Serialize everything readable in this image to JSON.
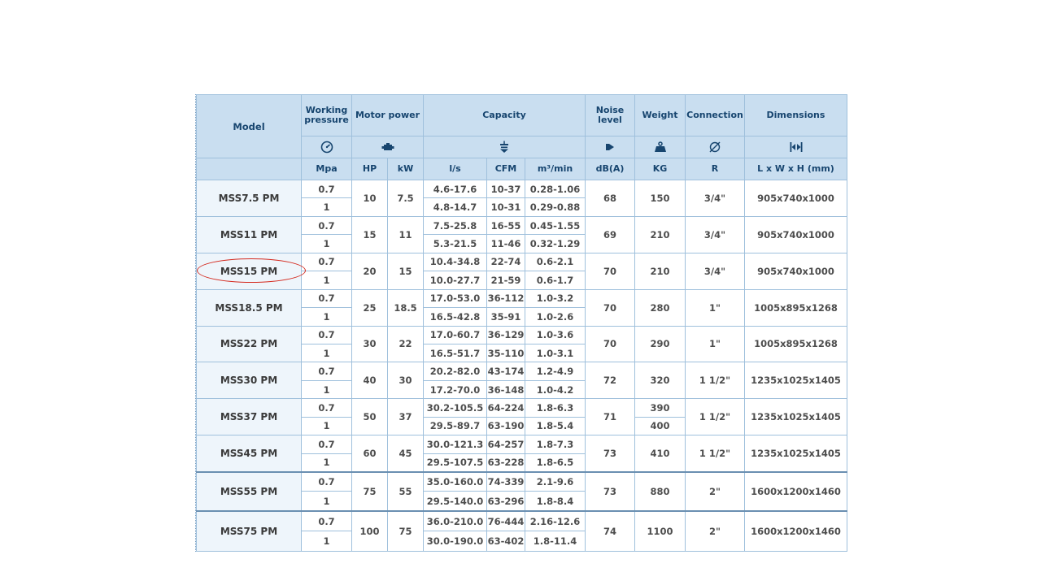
{
  "header": {
    "model": "Model",
    "working_pressure": "Working pressure",
    "motor_power": "Motor power",
    "capacity": "Capacity",
    "noise_level": "Noise level",
    "weight": "Weight",
    "connection": "Connection",
    "dimensions": "Dimensions",
    "icons": {
      "pressure": "pressure-gauge-icon",
      "motor": "motor-icon",
      "capacity": "airflow-icon",
      "noise": "speaker-icon",
      "weight": "weight-icon",
      "connection": "diameter-icon",
      "dimensions": "width-arrows-icon"
    },
    "units": {
      "pressure": "Mpa",
      "hp": "HP",
      "kw": "kW",
      "ls": "l/s",
      "cfm": "CFM",
      "m3min": "m³/min",
      "noise": "dB(A)",
      "weight": "KG",
      "connection": "R",
      "dimensions": "L x W x H (mm)"
    }
  },
  "rows": [
    {
      "model": "MSS7.5 PM",
      "hp": "10",
      "kw": "7.5",
      "noise": "68",
      "weight": "150",
      "connection": "3/4\"",
      "dimensions": "905x740x1000",
      "sub": [
        {
          "pressure": "0.7",
          "ls": "4.6-17.6",
          "cfm": "10-37",
          "m3min": "0.28-1.06"
        },
        {
          "pressure": "1",
          "ls": "4.8-14.7",
          "cfm": "10-31",
          "m3min": "0.29-0.88"
        }
      ]
    },
    {
      "model": "MSS11 PM",
      "hp": "15",
      "kw": "11",
      "noise": "69",
      "weight": "210",
      "connection": "3/4\"",
      "dimensions": "905x740x1000",
      "sub": [
        {
          "pressure": "0.7",
          "ls": "7.5-25.8",
          "cfm": "16-55",
          "m3min": "0.45-1.55"
        },
        {
          "pressure": "1",
          "ls": "5.3-21.5",
          "cfm": "11-46",
          "m3min": "0.32-1.29"
        }
      ]
    },
    {
      "model": "MSS15 PM",
      "hp": "20",
      "kw": "15",
      "noise": "70",
      "weight": "210",
      "connection": "3/4\"",
      "dimensions": "905x740x1000",
      "sub": [
        {
          "pressure": "0.7",
          "ls": "10.4-34.8",
          "cfm": "22-74",
          "m3min": "0.6-2.1"
        },
        {
          "pressure": "1",
          "ls": "10.0-27.7",
          "cfm": "21-59",
          "m3min": "0.6-1.7"
        }
      ]
    },
    {
      "model": "MSS18.5 PM",
      "hp": "25",
      "kw": "18.5",
      "noise": "70",
      "weight": "280",
      "connection": "1\"",
      "dimensions": "1005x895x1268",
      "sub": [
        {
          "pressure": "0.7",
          "ls": "17.0-53.0",
          "cfm": "36-112",
          "m3min": "1.0-3.2"
        },
        {
          "pressure": "1",
          "ls": "16.5-42.8",
          "cfm": "35-91",
          "m3min": "1.0-2.6"
        }
      ]
    },
    {
      "model": "MSS22 PM",
      "hp": "30",
      "kw": "22",
      "noise": "70",
      "weight": "290",
      "connection": "1\"",
      "dimensions": "1005x895x1268",
      "sub": [
        {
          "pressure": "0.7",
          "ls": "17.0-60.7",
          "cfm": "36-129",
          "m3min": "1.0-3.6"
        },
        {
          "pressure": "1",
          "ls": "16.5-51.7",
          "cfm": "35-110",
          "m3min": "1.0-3.1"
        }
      ]
    },
    {
      "model": "MSS30 PM",
      "hp": "40",
      "kw": "30",
      "noise": "72",
      "weight": "320",
      "connection": "1 1/2\"",
      "dimensions": "1235x1025x1405",
      "sub": [
        {
          "pressure": "0.7",
          "ls": "20.2-82.0",
          "cfm": "43-174",
          "m3min": "1.2-4.9"
        },
        {
          "pressure": "1",
          "ls": "17.2-70.0",
          "cfm": "36-148",
          "m3min": "1.0-4.2"
        }
      ]
    },
    {
      "model": "MSS37 PM",
      "hp": "50",
      "kw": "37",
      "noise": "71",
      "weight_split": [
        "390",
        "400"
      ],
      "connection": "1 1/2\"",
      "dimensions": "1235x1025x1405",
      "sub": [
        {
          "pressure": "0.7",
          "ls": "30.2-105.5",
          "cfm": "64-224",
          "m3min": "1.8-6.3"
        },
        {
          "pressure": "1",
          "ls": "29.5-89.7",
          "cfm": "63-190",
          "m3min": "1.8-5.4"
        }
      ]
    },
    {
      "model": "MSS45 PM",
      "hp": "60",
      "kw": "45",
      "noise": "73",
      "weight": "410",
      "connection": "1 1/2\"",
      "dimensions": "1235x1025x1405",
      "sub": [
        {
          "pressure": "0.7",
          "ls": "30.0-121.3",
          "cfm": "64-257",
          "m3min": "1.8-7.3"
        },
        {
          "pressure": "1",
          "ls": "29.5-107.5",
          "cfm": "63-228",
          "m3min": "1.8-6.5"
        }
      ]
    },
    {
      "model": "MSS55 PM",
      "hp": "75",
      "kw": "55",
      "noise": "73",
      "weight": "880",
      "connection": "2\"",
      "dimensions": "1600x1200x1460",
      "sub": [
        {
          "pressure": "0.7",
          "ls": "35.0-160.0",
          "cfm": "74-339",
          "m3min": "2.1-9.6"
        },
        {
          "pressure": "1",
          "ls": "29.5-140.0",
          "cfm": "63-296",
          "m3min": "1.8-8.4"
        }
      ]
    },
    {
      "model": "MSS75 PM",
      "hp": "100",
      "kw": "75",
      "noise": "74",
      "weight": "1100",
      "connection": "2\"",
      "dimensions": "1600x1200x1460",
      "sub": [
        {
          "pressure": "0.7",
          "ls": "36.0-210.0",
          "cfm": "76-444",
          "m3min": "2.16-12.6"
        },
        {
          "pressure": "1",
          "ls": "30.0-190.0",
          "cfm": "63-402",
          "m3min": "1.8-11.4"
        }
      ]
    }
  ],
  "highlight": {
    "color": "#d42a1f",
    "target": "MSS15 PM"
  }
}
